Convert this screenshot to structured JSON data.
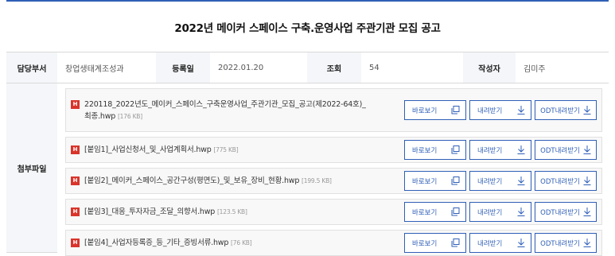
{
  "title": "2022년 메이커 스페이스 구축.운영사업 주관기관 모집 공고",
  "meta": {
    "dept_label": "담당부서",
    "dept_value": "창업생태계조성과",
    "date_label": "등록일",
    "date_value": "2022.01.20",
    "views_label": "조회",
    "views_value": "54",
    "author_label": "작성자",
    "author_value": "김미주"
  },
  "attachments": {
    "label": "첨부파일",
    "icon_text": "H",
    "buttons": {
      "view": "바로보기",
      "download": "내려받기",
      "odt": "ODT내려받기"
    },
    "files": [
      {
        "name_line1": "220118_2022년도_메이커_스페이스_구축운영사업_주관기관_모집_공고(제2022-64호)_",
        "name_line2": "최종.hwp",
        "size": "[176 KB]"
      },
      {
        "name_line1": "[붙임1]_사업신청서_및_사업계획서.hwp",
        "name_line2": "",
        "size": "[775 KB]"
      },
      {
        "name_line1": "[붙임2]_메이커_스페이스_공간구성(평면도)_및_보유_장비_현황.hwp",
        "name_line2": "",
        "size": "[199.5 KB]"
      },
      {
        "name_line1": "[붙임3]_대응_투자자금_조달_의향서.hwp",
        "name_line2": "",
        "size": "[123.5 KB]"
      },
      {
        "name_line1": "[붙임4]_사업자등록증_등_기타_증빙서류.hwp",
        "name_line2": "",
        "size": "[76 KB]"
      }
    ]
  },
  "colors": {
    "accent": "#2f5fb7",
    "file_icon": "#d9342b",
    "label_bg": "#f4f6f9"
  }
}
